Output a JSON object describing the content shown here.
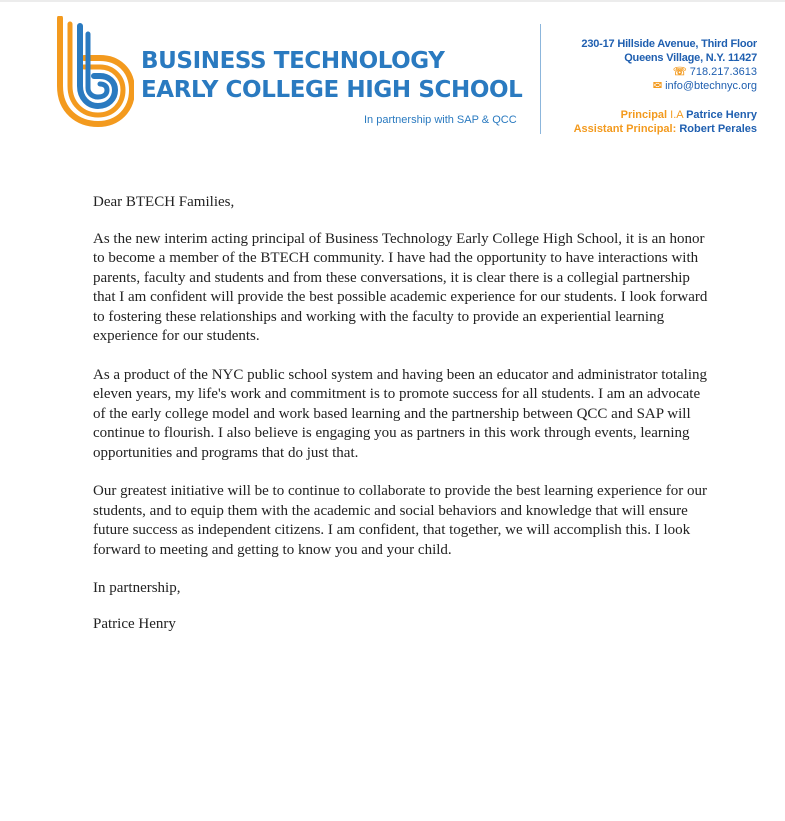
{
  "letterhead": {
    "school_name_line1": "BUSINESS TECHNOLOGY",
    "school_name_line2": "EARLY COLLEGE HIGH SCHOOL",
    "partnership_tagline": "In partnership with SAP & QCC",
    "address_line1": "230-17 Hillside Avenue, Third Floor",
    "address_line2": "Queens Village, N.Y. 11427",
    "phone": "718.217.3613",
    "email": "info@btechnyc.org",
    "principal_label": "Principal",
    "principal_title": "I.A",
    "principal_name": "Patrice Henry",
    "assistant_principal_label": "Assistant Principal:",
    "assistant_principal_name": "Robert Perales",
    "phone_icon": "phone-icon",
    "email_icon": "envelope-icon",
    "colors": {
      "brand_blue": "#2a7ac0",
      "brand_orange": "#f39a1e",
      "contact_blue": "#1f5fb0"
    }
  },
  "letter": {
    "salutation": "Dear BTECH Families,",
    "paragraphs": [
      "As the new interim acting principal of Business Technology Early College High School, it is an honor to become a member of the BTECH community.  I have had the opportunity to have interactions with parents, faculty and students and from these conversations, it is clear there is a collegial partnership that I am confident will provide the best possible academic experience for our students. I look forward to fostering these relationships and working with the faculty to provide an experiential learning experience for our students.",
      "As a product of the NYC public school system and having been an educator and administrator totaling eleven years, my life's work and commitment is to promote success for all students. I am an advocate of the early college model and work based learning and the partnership between QCC and SAP will continue to flourish. I also believe is engaging you as partners in this work through events, learning opportunities and programs that do just that.",
      "Our greatest initiative will be to continue to collaborate to provide the best learning experience for our students, and to equip them with the academic and social behaviors and knowledge that will ensure future success as independent citizens. I am confident, that together, we will accomplish this.  I look forward to meeting and getting to know you and your child."
    ],
    "closing": "In partnership,",
    "signature": "Patrice Henry"
  }
}
